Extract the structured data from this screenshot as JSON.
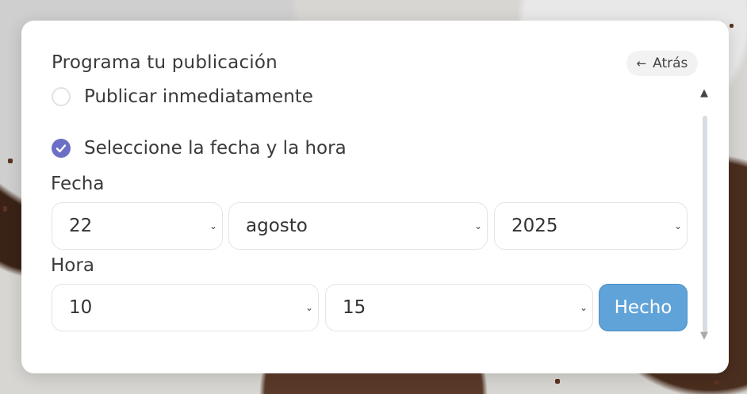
{
  "modal": {
    "title": "Programa tu publicación",
    "back_label": "Atrás"
  },
  "options": {
    "immediate_label": "Publicar inmediatamente",
    "schedule_label": "Seleccione la fecha y la hora",
    "selected": "schedule"
  },
  "date": {
    "label": "Fecha",
    "day": "22",
    "month": "agosto",
    "year": "2025"
  },
  "time": {
    "label": "Hora",
    "hour": "10",
    "minute": "15"
  },
  "done_label": "Hecho",
  "colors": {
    "accent": "#6b70c6",
    "done_button": "#5fa3d8"
  }
}
